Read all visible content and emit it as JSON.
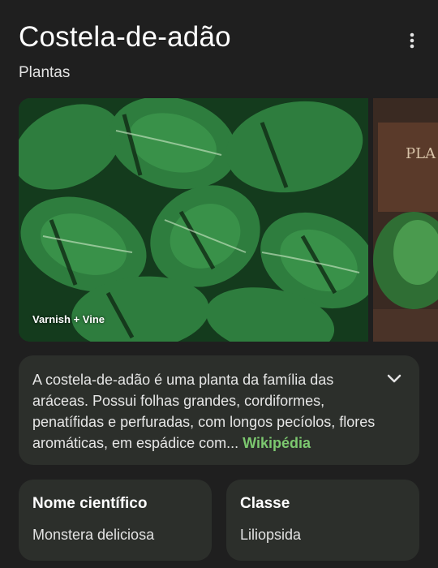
{
  "header": {
    "title": "Costela-de-adão",
    "subtitle": "Plantas"
  },
  "gallery": {
    "main_caption": "Varnish + Vine",
    "second_sign_text": "PLA"
  },
  "description": {
    "text": "A costela-de-adão é uma planta da família das aráceas. Possui folhas grandes, cordiformes, penatífidas e perfuradas, com longos pecíolos, flores aromáticas, em espádice com...",
    "source_link": "Wikipédia"
  },
  "facts": [
    {
      "label": "Nome científico",
      "value": "Monstera deliciosa"
    },
    {
      "label": "Classe",
      "value": "Liliopsida"
    }
  ],
  "colors": {
    "background": "#1f1f1f",
    "card": "#2c2f2b",
    "link": "#7cc86f"
  },
  "icons": {
    "menu": "more-vert-icon",
    "expand": "chevron-down-icon"
  }
}
